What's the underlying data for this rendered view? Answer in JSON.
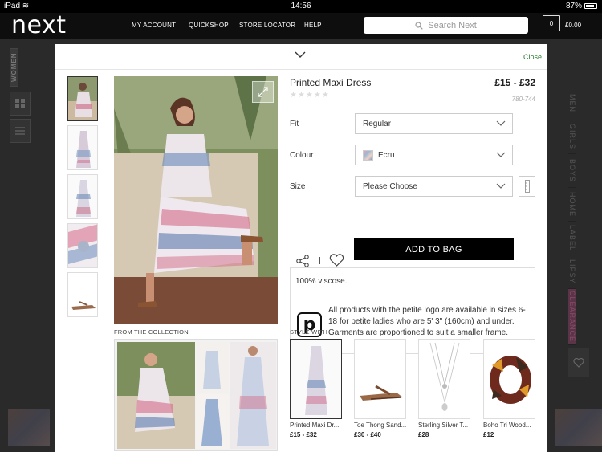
{
  "status_bar": {
    "device": "iPad",
    "time": "14:56",
    "battery": "87%",
    "battery_level": 0.87
  },
  "header": {
    "logo": "next",
    "nav": [
      "MY ACCOUNT",
      "QUICKSHOP",
      "STORE LOCATOR",
      "HELP"
    ],
    "search_placeholder": "Search Next",
    "bag_count": "0",
    "bag_total": "£0.00"
  },
  "background": {
    "left_tab": "WOMEN",
    "right_tabs": [
      "MEN",
      "GIRLS",
      "BOYS",
      "HOME",
      "LABEL",
      "LIPSY",
      "CLEARANCE"
    ]
  },
  "modal": {
    "close_label": "Close",
    "product": {
      "title": "Printed Maxi Dress",
      "price": "£15 - £32",
      "stars": "★★★★★",
      "rating": 0,
      "code": "780-744"
    },
    "options": {
      "fit_label": "Fit",
      "fit_value": "Regular",
      "colour_label": "Colour",
      "colour_value": "Ecru",
      "size_label": "Size",
      "size_value": "Please Choose"
    },
    "add_to_bag": "ADD TO BAG",
    "description": {
      "fabric": "100% viscose.",
      "petite_note": "All products with the petite logo are available in sizes 6-18 for petite ladies who are 5' 3\" (160cm) and under. Garments are proportioned to suit a smaller frame.",
      "petite_logo_letter": "p"
    },
    "from_collection_label": "FROM THE COLLECTION",
    "style_with_label": "STYLE WITH",
    "style_with": [
      {
        "name": "Printed Maxi Dr...",
        "price": "£15 - £32"
      },
      {
        "name": "Toe Thong Sand...",
        "price": "£30 - £40"
      },
      {
        "name": "Sterling Silver T...",
        "price": "£28"
      },
      {
        "name": "Boho Tri Wood...",
        "price": "£12"
      }
    ]
  },
  "colors": {
    "close_link": "#2e7d32",
    "add_to_bag_bg": "#000000",
    "header_bg": "#0e0e0e"
  }
}
